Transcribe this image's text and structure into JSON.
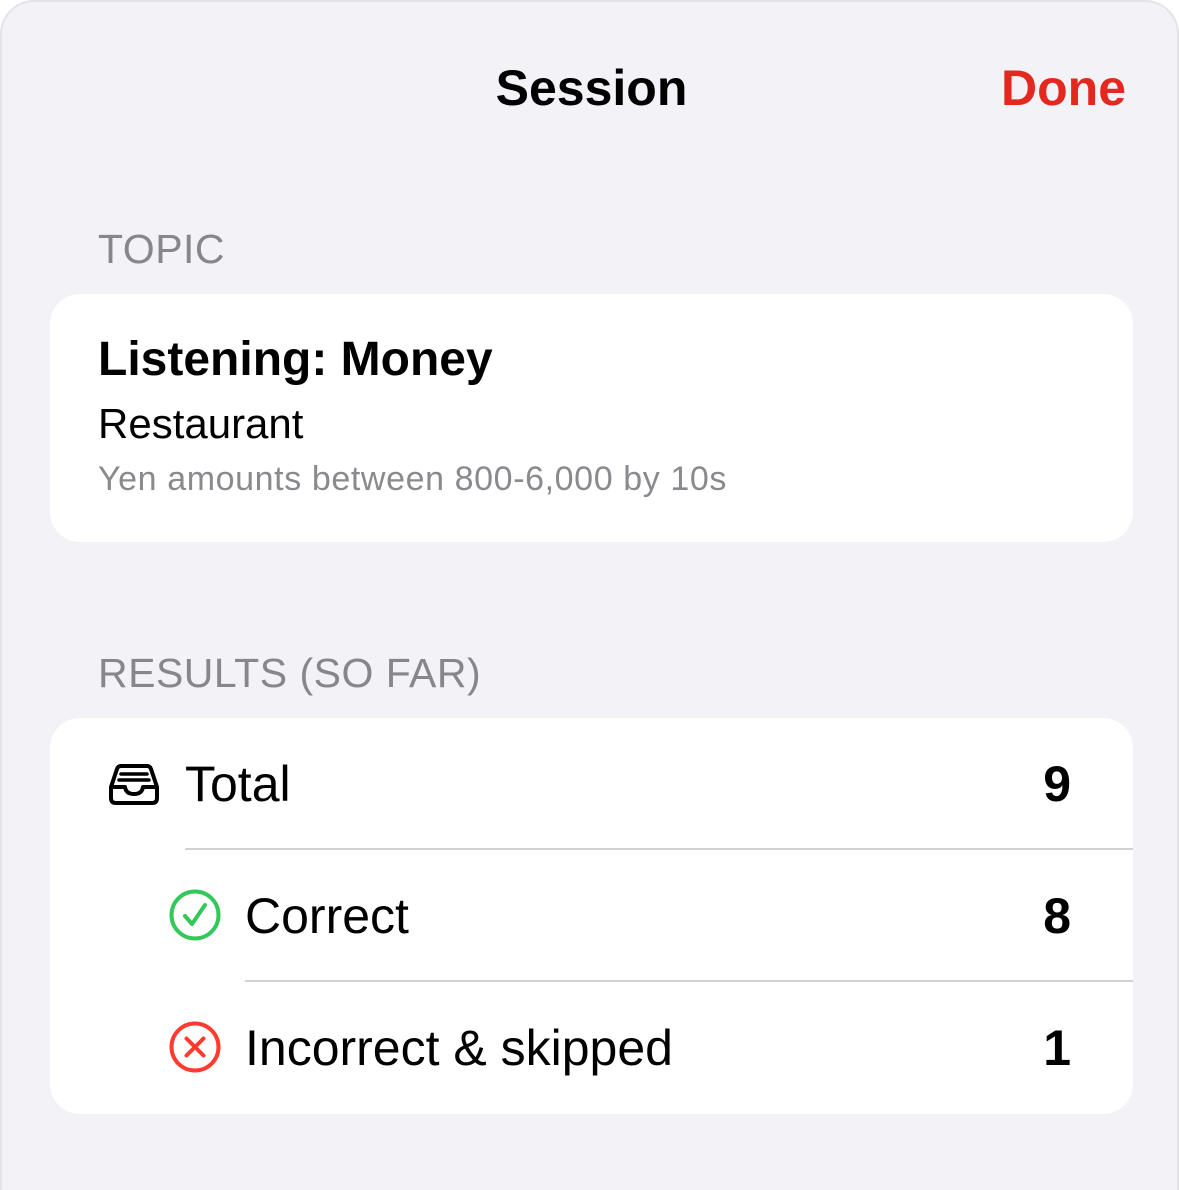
{
  "header": {
    "title": "Session",
    "done_label": "Done"
  },
  "topic_section": {
    "header": "TOPIC",
    "title": "Listening: Money",
    "subtitle": "Restaurant",
    "description": "Yen amounts between 800-6,000 by 10s"
  },
  "results_section": {
    "header": "RESULTS (SO FAR)",
    "rows": [
      {
        "icon": "tray-icon",
        "label": "Total",
        "value": "9"
      },
      {
        "icon": "checkmark-circle-icon",
        "label": "Correct",
        "value": "8"
      },
      {
        "icon": "x-circle-icon",
        "label": "Incorrect & skipped",
        "value": "1"
      }
    ]
  },
  "colors": {
    "accent": "#e5281f",
    "correct": "#34c759",
    "incorrect": "#ff3b30",
    "background": "#f2f2f7"
  }
}
